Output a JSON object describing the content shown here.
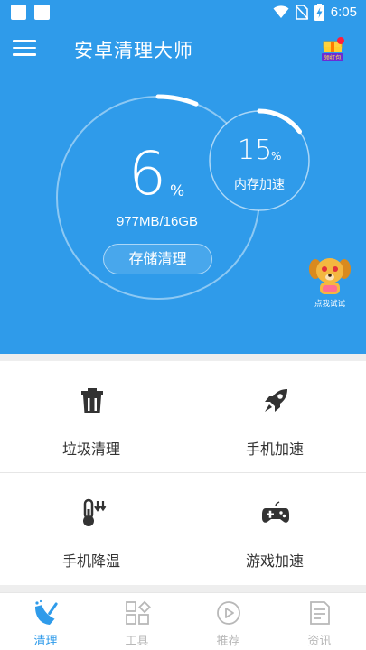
{
  "status_bar": {
    "time": "6:05"
  },
  "header": {
    "title": "安卓清理大师",
    "gift_badge": "领红包"
  },
  "hero": {
    "storage_percent": "6",
    "percent_sign": "%",
    "storage_size": "977MB/16GB",
    "storage_button": "存储清理",
    "memory_percent": "15",
    "memory_percent_sign": "%",
    "memory_label": "内存加速",
    "mascot_caption": "点我试试"
  },
  "features": [
    {
      "label": "垃圾清理",
      "icon": "trash-icon"
    },
    {
      "label": "手机加速",
      "icon": "rocket-icon"
    },
    {
      "label": "手机降温",
      "icon": "thermometer-icon"
    },
    {
      "label": "游戏加速",
      "icon": "gamepad-icon"
    }
  ],
  "bottom_nav": [
    {
      "label": "清理",
      "icon": "broom-icon",
      "active": true
    },
    {
      "label": "工具",
      "icon": "grid-tools-icon",
      "active": false
    },
    {
      "label": "推荐",
      "icon": "play-icon",
      "active": false
    },
    {
      "label": "资讯",
      "icon": "news-icon",
      "active": false
    }
  ],
  "colors": {
    "primary": "#2f9bea",
    "text_dark": "#333333",
    "nav_inactive": "#b8b8b8"
  }
}
